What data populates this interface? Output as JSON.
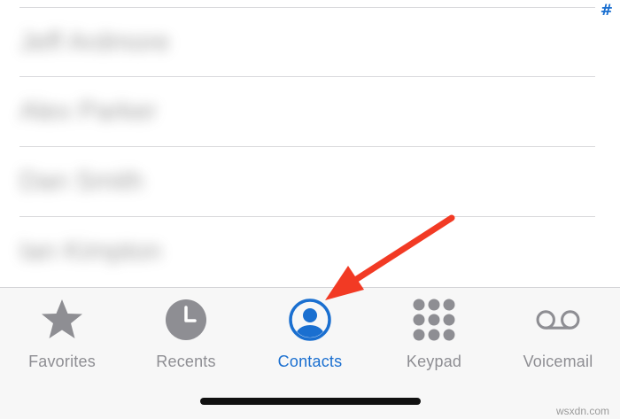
{
  "contacts": [
    {
      "name": "Jeff Ardmore"
    },
    {
      "name": "Alex Parker"
    },
    {
      "name": "Dan Smith"
    },
    {
      "name": "Ian Kimpton"
    }
  ],
  "index": {
    "symbol": "#"
  },
  "tabs": [
    {
      "label": "Favorites",
      "icon": "star-icon"
    },
    {
      "label": "Recents",
      "icon": "clock-icon"
    },
    {
      "label": "Contacts",
      "icon": "person-circle-icon",
      "active": true
    },
    {
      "label": "Keypad",
      "icon": "keypad-icon"
    },
    {
      "label": "Voicemail",
      "icon": "voicemail-icon"
    }
  ],
  "colors": {
    "accent": "#1a6fd0",
    "inactive": "#8e8e93",
    "annotation_arrow": "#f23a24"
  },
  "watermark": "wsxdn.com"
}
